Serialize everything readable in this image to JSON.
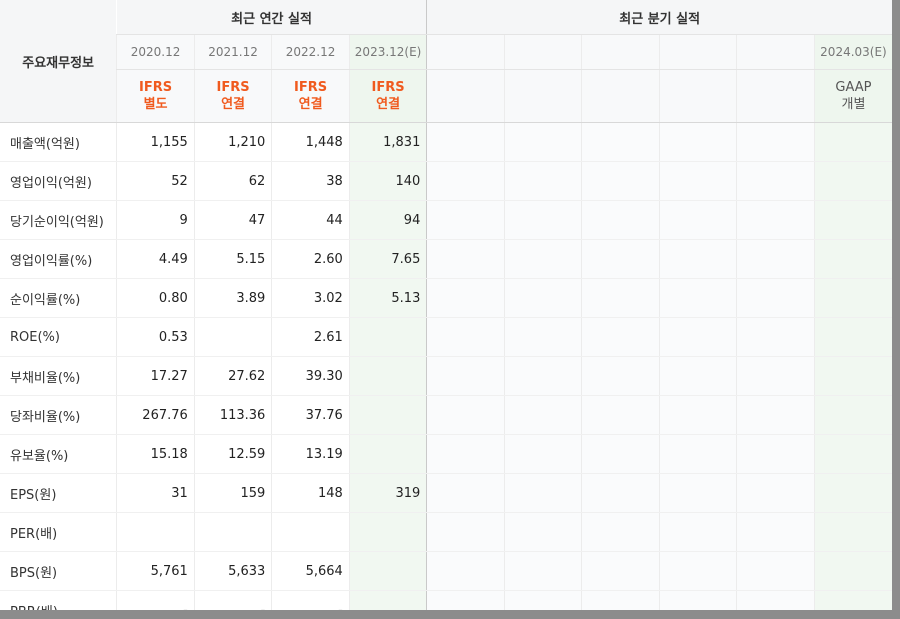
{
  "header": {
    "row_title": "주요재무정보",
    "annual_title": "최근 연간 실적",
    "quarter_title": "최근 분기 실적"
  },
  "annual_periods": [
    {
      "period": "2020.12",
      "std1": "IFRS",
      "std2": "별도"
    },
    {
      "period": "2021.12",
      "std1": "IFRS",
      "std2": "연결"
    },
    {
      "period": "2022.12",
      "std1": "IFRS",
      "std2": "연결"
    },
    {
      "period": "2023.12(E)",
      "std1": "IFRS",
      "std2": "연결"
    }
  ],
  "quarter_periods": [
    {
      "period": "",
      "std1": "",
      "std2": ""
    },
    {
      "period": "",
      "std1": "",
      "std2": ""
    },
    {
      "period": "",
      "std1": "",
      "std2": ""
    },
    {
      "period": "",
      "std1": "",
      "std2": ""
    },
    {
      "period": "",
      "std1": "",
      "std2": ""
    },
    {
      "period": "2024.03(E)",
      "std1": "GAAP",
      "std2": "개별"
    }
  ],
  "rows": [
    {
      "label": "매출액(억원)",
      "values": [
        "1,155",
        "1,210",
        "1,448",
        "1,831"
      ]
    },
    {
      "label": "영업이익(억원)",
      "values": [
        "52",
        "62",
        "38",
        "140"
      ]
    },
    {
      "label": "당기순이익(억원)",
      "values": [
        "9",
        "47",
        "44",
        "94"
      ]
    },
    {
      "label": "영업이익률(%)",
      "values": [
        "4.49",
        "5.15",
        "2.60",
        "7.65"
      ]
    },
    {
      "label": "순이익률(%)",
      "values": [
        "0.80",
        "3.89",
        "3.02",
        "5.13"
      ]
    },
    {
      "label": "ROE(%)",
      "values": [
        "0.53",
        "",
        "2.61",
        ""
      ]
    },
    {
      "label": "부채비율(%)",
      "values": [
        "17.27",
        "27.62",
        "39.30",
        ""
      ]
    },
    {
      "label": "당좌비율(%)",
      "values": [
        "267.76",
        "113.36",
        "37.76",
        ""
      ]
    },
    {
      "label": "유보율(%)",
      "values": [
        "15.18",
        "12.59",
        "13.19",
        ""
      ]
    },
    {
      "label": "EPS(원)",
      "values": [
        "31",
        "159",
        "148",
        "319"
      ]
    },
    {
      "label": "PER(배)",
      "values": [
        "",
        "",
        "",
        ""
      ]
    },
    {
      "label": "BPS(원)",
      "values": [
        "5,761",
        "5,633",
        "5,664",
        ""
      ]
    },
    {
      "label": "PBR(배)",
      "values": [
        "-",
        "-",
        "-",
        ""
      ]
    }
  ]
}
